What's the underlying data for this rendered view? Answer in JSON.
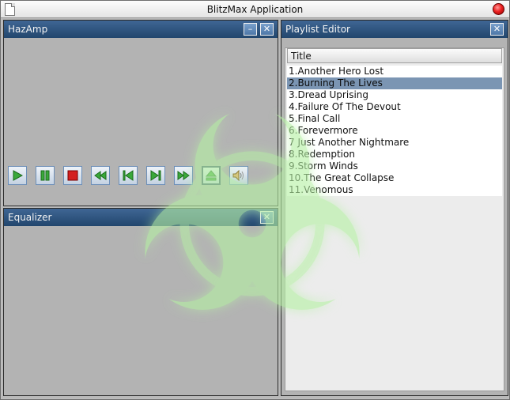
{
  "window": {
    "title": "BlitzMax Application"
  },
  "hazamp": {
    "title": "HazAmp",
    "minimize_label": "–",
    "close_label": "✕",
    "controls": [
      {
        "name": "play-button",
        "icon": "play-icon"
      },
      {
        "name": "pause-button",
        "icon": "pause-icon"
      },
      {
        "name": "stop-button",
        "icon": "stop-icon"
      },
      {
        "name": "rewind-button",
        "icon": "rewind-icon"
      },
      {
        "name": "previous-track-button",
        "icon": "skip-back-icon"
      },
      {
        "name": "next-track-button",
        "icon": "skip-forward-icon"
      },
      {
        "name": "fast-forward-button",
        "icon": "fast-forward-icon"
      },
      {
        "name": "eject-button",
        "icon": "eject-icon"
      },
      {
        "name": "volume-button",
        "icon": "speaker-icon"
      }
    ]
  },
  "equalizer": {
    "title": "Equalizer",
    "close_label": "✕"
  },
  "playlist": {
    "title": "Playlist Editor",
    "close_label": "✕",
    "column_title": "Title",
    "selected_index": 1,
    "tracks": [
      "1.Another Hero Lost",
      "2.Burning The Lives",
      "3.Dread Uprising",
      "4.Failure Of The Devout",
      "5.Final Call",
      "6.Forevermore",
      "7 Just Another Nightmare",
      "8.Redemption",
      "9.Storm Winds",
      "10.The Great Collapse",
      "11.Venomous"
    ]
  },
  "colors": {
    "panel_header": "#2f5680",
    "selection": "#7b95b3",
    "play_green": "#3aa83a",
    "stop_red": "#d42020"
  }
}
